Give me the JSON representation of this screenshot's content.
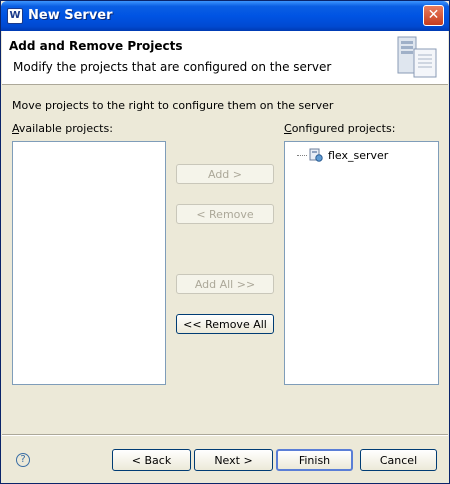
{
  "window": {
    "title": "New Server",
    "icon": "eclipse-window-icon"
  },
  "banner": {
    "title": "Add and Remove Projects",
    "description": "Modify the projects that are configured on the server"
  },
  "instruction": "Move projects to the right to configure them on the server",
  "available": {
    "label_mnemonic": "A",
    "label_rest": "vailable projects:",
    "items": []
  },
  "configured": {
    "label_mnemonic": "C",
    "label_rest": "onfigured projects:",
    "items": [
      {
        "label": "flex_server",
        "icon": "project-server-icon"
      }
    ]
  },
  "buttons": {
    "add": {
      "label": "Add >",
      "enabled": false
    },
    "remove": {
      "label": "< Remove",
      "enabled": false
    },
    "add_all": {
      "label": "Add All >>",
      "enabled": false
    },
    "remove_all": {
      "label": "<< Remove All",
      "enabled": true
    }
  },
  "footer": {
    "back": "< Back",
    "next": "Next >",
    "finish": "Finish",
    "cancel": "Cancel"
  }
}
